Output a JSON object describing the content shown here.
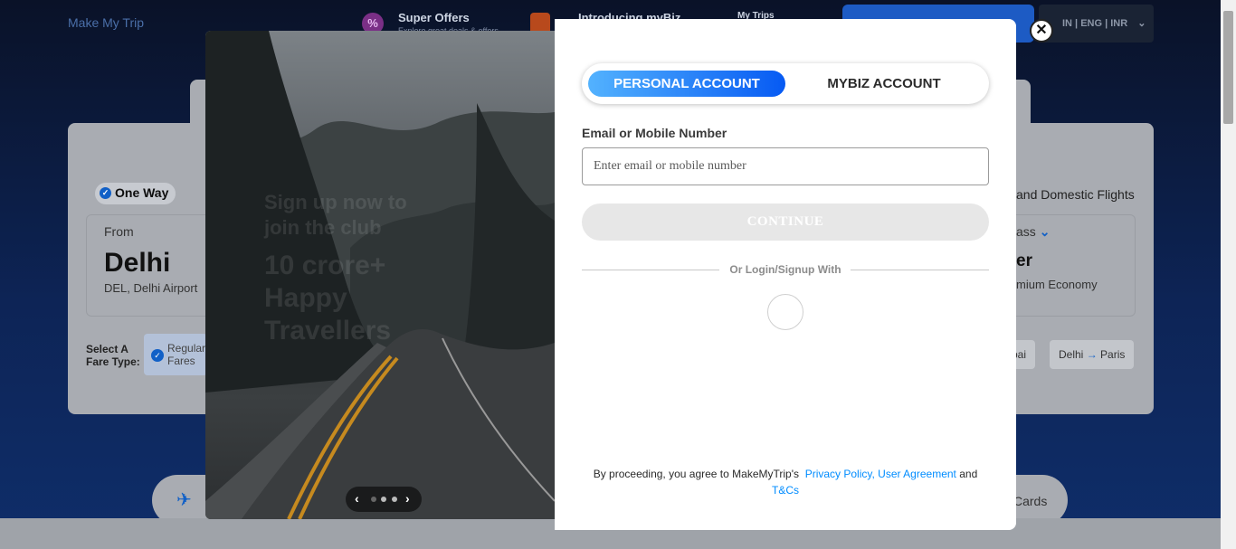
{
  "header": {
    "logo_alt": "Make My Trip",
    "super_offers": {
      "title": "Super Offers",
      "subtitle": "Explore great deals & offers",
      "icon": "percent-icon"
    },
    "mybiz": {
      "title": "Introducing myBiz"
    },
    "my_trips": {
      "title": "My Trips"
    },
    "locale": "IN | ENG | INR"
  },
  "search": {
    "trip_type": "One Way",
    "intl_label": "and Domestic Flights",
    "from_label": "From",
    "from_city": "Delhi",
    "from_sub": "DEL, Delhi Airport",
    "class_label": "ass",
    "class_value": "er",
    "class_sub": "mium Economy",
    "fare_label": "Select A Fare Type:",
    "fare_chip": "Regular Fares",
    "routes": [
      {
        "from": "",
        "to": "bai"
      },
      {
        "from": "Delhi",
        "to": "Paris"
      }
    ],
    "bottom_cards_text": "Cards"
  },
  "promo": {
    "line1": "Sign up now to",
    "line1b": "join the club",
    "line2": "10 crore+",
    "line2b": "Happy",
    "line2c": "Travellers"
  },
  "modal": {
    "tabs": {
      "personal": "PERSONAL ACCOUNT",
      "mybiz": "MYBIZ ACCOUNT"
    },
    "email_label": "Email or Mobile Number",
    "email_placeholder": "Enter email or mobile number",
    "email_value": "",
    "continue_label": "CONTINUE",
    "divider_text": "Or Login/Signup With",
    "terms_prefix": "By proceeding, you agree to MakeMyTrip's",
    "privacy_link": "Privacy Policy,",
    "user_agreement_link": "User Agreement",
    "terms_and": "and",
    "tnc_link": "T&Cs",
    "close_symbol": "✕"
  },
  "colors": {
    "accent": "#008cff",
    "active_tab_start": "#53b2fe",
    "active_tab_end": "#065af3",
    "continue_disabled": "#e7e7e7"
  }
}
